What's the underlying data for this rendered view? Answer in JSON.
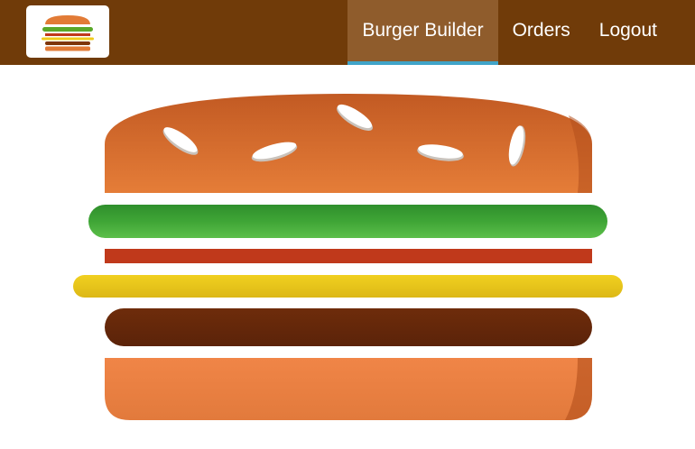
{
  "nav": {
    "items": [
      {
        "label": "Burger Builder",
        "active": true
      },
      {
        "label": "Orders",
        "active": false
      },
      {
        "label": "Logout",
        "active": false
      }
    ]
  },
  "burger": {
    "ingredients": [
      "bread-top",
      "salad",
      "bacon",
      "cheese",
      "meat",
      "bread-bottom"
    ]
  },
  "colors": {
    "toolbar": "#703b09",
    "active_tab": "#8f5c2c",
    "active_indicator": "#40a4c8",
    "bread": "#e27b36",
    "salad": "#4c9a2a",
    "bacon": "#bf3813",
    "cheese": "#f4d004",
    "meat": "#7f3608"
  }
}
